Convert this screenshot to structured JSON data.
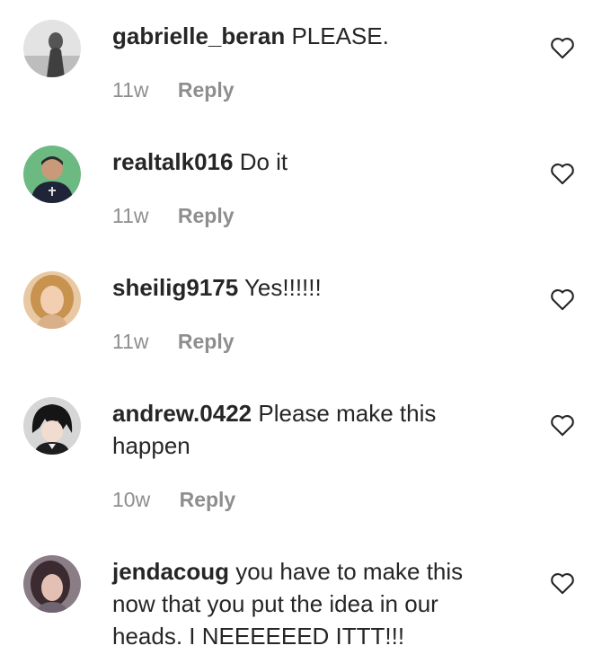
{
  "comments": [
    {
      "username": "gabrielle_beran",
      "text": "PLEASE.",
      "time": "11w",
      "reply_label": "Reply",
      "avatar_colors": [
        "#d9d9d9",
        "#4a4a4a"
      ]
    },
    {
      "username": "realtalk016",
      "text": "Do it",
      "time": "11w",
      "reply_label": "Reply",
      "avatar_colors": [
        "#5fae74",
        "#1f2438"
      ]
    },
    {
      "username": "sheilig9175",
      "text": "Yes!!!!!!",
      "time": "11w",
      "reply_label": "Reply",
      "avatar_colors": [
        "#d9a36a",
        "#f0d2b4"
      ]
    },
    {
      "username": "andrew.0422",
      "text": "Please make this happen",
      "time": "10w",
      "reply_label": "Reply",
      "avatar_colors": [
        "#c9c9c9",
        "#1a1a1a"
      ]
    },
    {
      "username": "jendacoug",
      "text": "you have to make this now that you put the idea in our heads. I NEEEEEED ITTT!!!",
      "avatar_colors": [
        "#9a7f8f",
        "#3a2d30"
      ]
    }
  ],
  "colors": {
    "text": "#262626",
    "secondary": "#8e8e8e"
  }
}
